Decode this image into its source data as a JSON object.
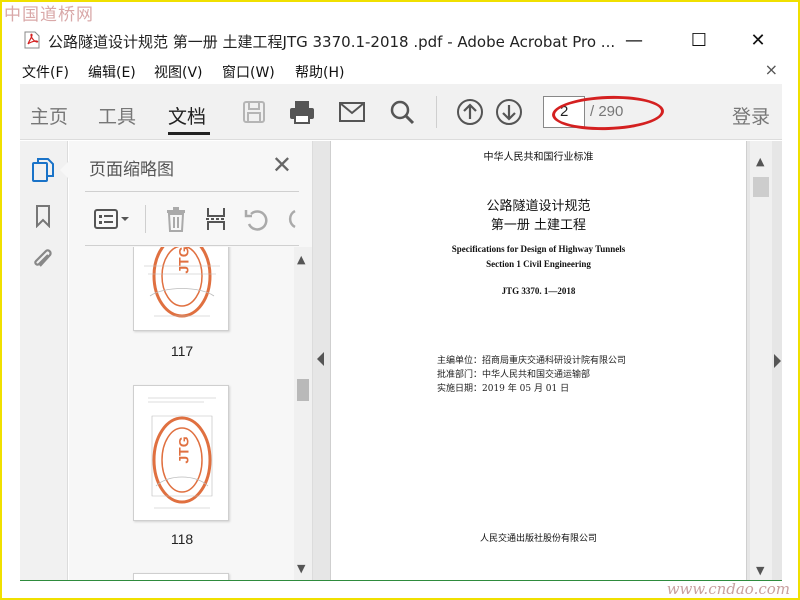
{
  "watermark": {
    "top": "中国道桥网",
    "bottom": "www.cndao.com"
  },
  "window": {
    "title": "公路隧道设计规范 第一册 土建工程JTG 3370.1-2018 .pdf - Adobe Acrobat Pro ...",
    "minimize": "—",
    "maximize": "☐",
    "close": "✕"
  },
  "menu": {
    "items": [
      "文件(F)",
      "编辑(E)",
      "视图(V)",
      "窗口(W)",
      "帮助(H)"
    ],
    "close": "×"
  },
  "toolbar": {
    "tabs": [
      "主页",
      "工具",
      "文档"
    ],
    "active_tab": "文档",
    "page_current": "2",
    "page_total": "/ 290",
    "login": "登录",
    "icons": [
      "save-icon",
      "print-icon",
      "email-icon",
      "search-icon",
      "page-up-icon",
      "page-down-icon"
    ]
  },
  "sidebar": {
    "icons": [
      "page-thumbnails-icon",
      "bookmark-icon",
      "attachment-icon"
    ]
  },
  "thumbnail_panel": {
    "title": "页面缩略图",
    "close": "✕",
    "thumbnails": [
      {
        "label": "117",
        "stamp": "JTG"
      },
      {
        "label": "118",
        "stamp": "JTG"
      }
    ]
  },
  "document": {
    "header": "中华人民共和国行业标准",
    "title_cn": "公路隧道设计规范",
    "subtitle_cn": "第一册    土建工程",
    "title_en": "Specifications for Design of Highway Tunnels",
    "subtitle_en": "Section 1    Civil Engineering",
    "code": "JTG  3370. 1—2018",
    "info": [
      "主编单位：招商局重庆交通科研设计院有限公司",
      "批准部门：中华人民共和国交通运输部",
      "实施日期：2019 年 05 月 01 日"
    ],
    "publisher": "人民交通出版社股份有限公司"
  },
  "colors": {
    "annotation_red": "#d42020",
    "stamp_orange": "#e07040",
    "frame_yellow": "#f0e000"
  }
}
